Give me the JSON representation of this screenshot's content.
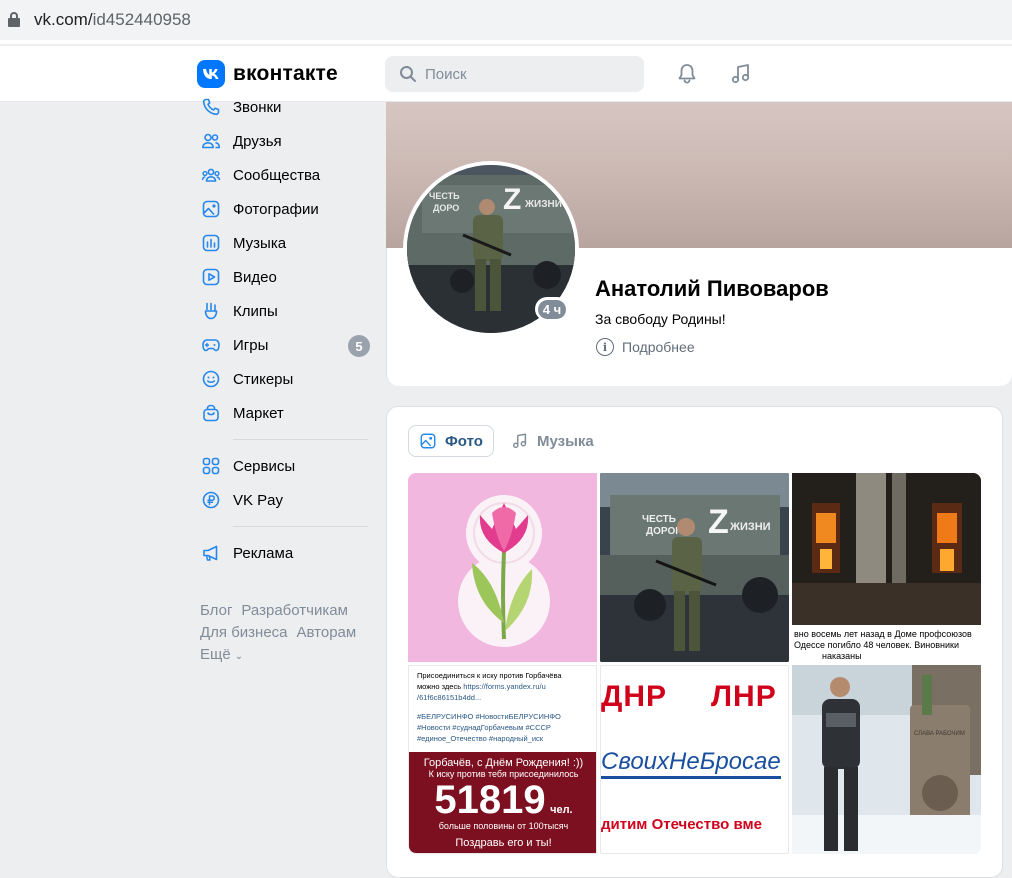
{
  "browser": {
    "url_host": "vk.com/",
    "url_path": "id452440958"
  },
  "header": {
    "logo_text": "вконтакте",
    "search_placeholder": "Поиск"
  },
  "sidebar": {
    "items": [
      {
        "label": "Звонки",
        "icon": "phone-icon"
      },
      {
        "label": "Друзья",
        "icon": "friends-icon"
      },
      {
        "label": "Сообщества",
        "icon": "communities-icon"
      },
      {
        "label": "Фотографии",
        "icon": "photos-icon"
      },
      {
        "label": "Музыка",
        "icon": "music-icon"
      },
      {
        "label": "Видео",
        "icon": "video-icon"
      },
      {
        "label": "Клипы",
        "icon": "clips-icon"
      },
      {
        "label": "Игры",
        "icon": "games-icon",
        "badge": "5"
      },
      {
        "label": "Стикеры",
        "icon": "stickers-icon"
      },
      {
        "label": "Маркет",
        "icon": "market-icon"
      }
    ],
    "items2": [
      {
        "label": "Сервисы",
        "icon": "services-icon"
      },
      {
        "label": "VK Pay",
        "icon": "vkpay-icon"
      }
    ],
    "items3": [
      {
        "label": "Реклама",
        "icon": "ads-icon"
      }
    ],
    "footer": {
      "blog": "Блог",
      "developers": "Разработчикам",
      "business": "Для бизнеса",
      "authors": "Авторам",
      "more": "Ещё"
    }
  },
  "profile": {
    "name": "Анатолий Пивоваров",
    "status": "За свободу Родины!",
    "online": "4 ч",
    "more_label": "Подробнее",
    "avatar_texts": {
      "line1": "ЧЕСТЬ",
      "line2": "ДОРО",
      "letter": "Z",
      "line3": "ЖИЗНИ"
    }
  },
  "media": {
    "tabs": [
      {
        "label": "Фото",
        "active": true
      },
      {
        "label": "Музыка",
        "active": false
      }
    ],
    "photo2_text": {
      "line1": "ЧЕСТЬ",
      "line2": "ДОРОГА",
      "letter": "Z",
      "line3": "ЖИЗНИ"
    },
    "photo3_caption": {
      "line1": "вно восемь лет назад в Доме профсоюзов",
      "line2": "Одессе погибло 48 человек. Виновники",
      "line3": "наказаны"
    },
    "photo4": {
      "line1": "Присоединиться к иску против Горбачёва",
      "line2": "можно здесь",
      "link": "https://forms.yandex.ru/u",
      "link2": "/61f6c86151b4dd...",
      "tags1": "#БЕЛРУСИНФО #НовостиБЕЛРУСИНФО",
      "tags2": "#Новости #суднадГорбачевым #СССР",
      "tags3": "#единое_Отечество #народный_иск",
      "red1": "Горбачёв, с Днём Рождения! :))",
      "red2": "К иску против тебя присоединилось",
      "big": "51819",
      "chel": "чел.",
      "red3": "больше половины от 100тысяч",
      "red4": "Поздравь его и ты!"
    },
    "photo5": {
      "dnr": "ДНР",
      "lnr": "ЛНР",
      "hashtag": "СвоихНеБросае",
      "slogan": "дитим Отечество вме"
    },
    "photo6_text": "СЛАВА РАБОЧИМ"
  }
}
